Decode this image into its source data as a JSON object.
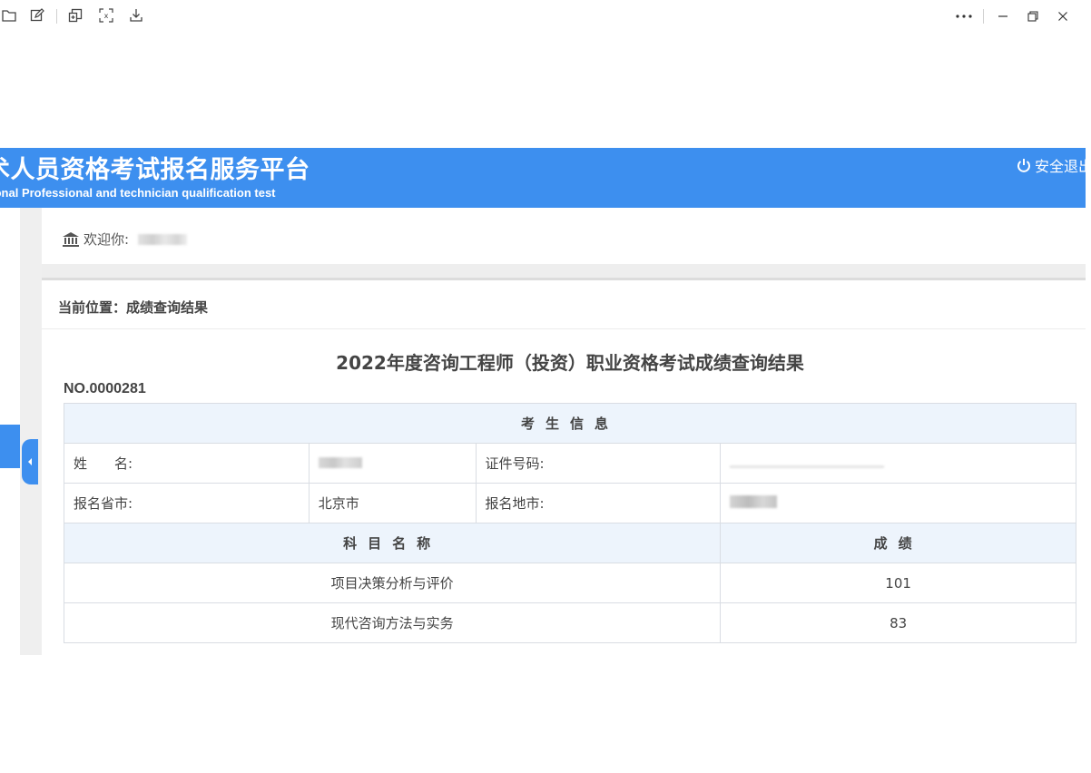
{
  "header": {
    "title": "术人员资格考试报名服务平台",
    "subtitle": "ional Professional and technician qualification test",
    "logout": "安全退出"
  },
  "welcome": {
    "label": "欢迎你:"
  },
  "breadcrumb": "当前位置：成绩查询结果",
  "report": {
    "title": "2022年度咨询工程师（投资）职业资格考试成绩查询结果",
    "number": "NO.0000281",
    "section_candidate": "考生信息",
    "name_label": "姓　　名:",
    "id_label": "证件号码:",
    "province_label": "报名省市:",
    "province_value": "北京市",
    "city_label": "报名地市:",
    "subject_header": "科目名称",
    "score_header": "成绩",
    "subjects": [
      {
        "name": "项目决策分析与评价",
        "score": "101"
      },
      {
        "name": "现代咨询方法与实务",
        "score": "83"
      }
    ]
  }
}
